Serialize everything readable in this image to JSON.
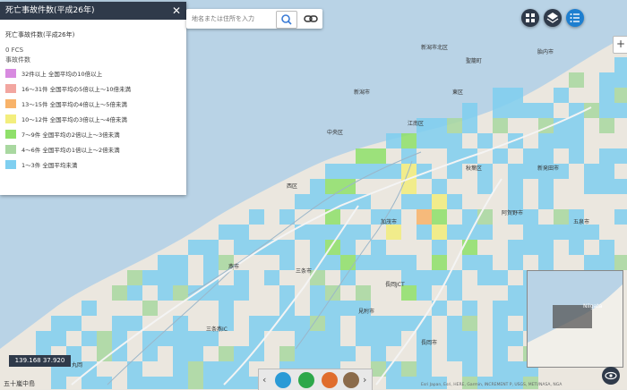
{
  "panel": {
    "title": "死亡事故件数(平成26年)",
    "close": "✕",
    "layer_title": "死亡事故件数(平成26年)",
    "subline": "0  FCS",
    "attribute": "事故件数",
    "legend": [
      {
        "label": "32件以上 全国平均の10倍以上",
        "color": "#d88be0"
      },
      {
        "label": "16〜31件 全国平均の5倍以上〜10倍未満",
        "color": "#f2a6a0"
      },
      {
        "label": "13〜15件 全国平均の4倍以上〜5倍未満",
        "color": "#f8b36a"
      },
      {
        "label": "10〜12件 全国平均の3倍以上〜4倍未満",
        "color": "#f3ee7d"
      },
      {
        "label": "7〜9件 全国平均の2倍以上〜3倍未満",
        "color": "#8fe06a"
      },
      {
        "label": "4〜6件 全国平均の1倍以上〜2倍未満",
        "color": "#a9d8a0"
      },
      {
        "label": "1〜3件 全国平均未満",
        "color": "#7fcff0"
      }
    ]
  },
  "search": {
    "placeholder": "地名または住所を入力"
  },
  "coords": "139.168 37.920",
  "corner_label": "五十嵐中島",
  "credits": "Esri Japan, Esri, HERE, Garmin, INCREMENT P, USGS, METI/NASA, NGA",
  "place_labels": [
    {
      "t": "新潟市北区"
    },
    {
      "t": "新潟市"
    },
    {
      "t": "中央区"
    },
    {
      "t": "東区"
    },
    {
      "t": "江南区"
    },
    {
      "t": "秋葉区"
    },
    {
      "t": "西区"
    },
    {
      "t": "燕市"
    },
    {
      "t": "三条市"
    },
    {
      "t": "加茂市"
    },
    {
      "t": "見附市"
    },
    {
      "t": "長岡市"
    },
    {
      "t": "新発田市"
    },
    {
      "t": "阿賀野市"
    },
    {
      "t": "五泉市"
    },
    {
      "t": "聖籠町"
    },
    {
      "t": "胎内市"
    },
    {
      "t": "丸岡"
    },
    {
      "t": "三条燕IC"
    },
    {
      "t": "長岡JCT"
    },
    {
      "t": "Niigata"
    }
  ],
  "colors": {
    "accent": "#2f3a4a",
    "sea": "#b9d3e6",
    "land": "#ebe7df"
  },
  "icons": [
    "close-icon",
    "search-icon",
    "link-icon",
    "grid-icon",
    "layers-icon",
    "list-icon",
    "eye-icon"
  ]
}
